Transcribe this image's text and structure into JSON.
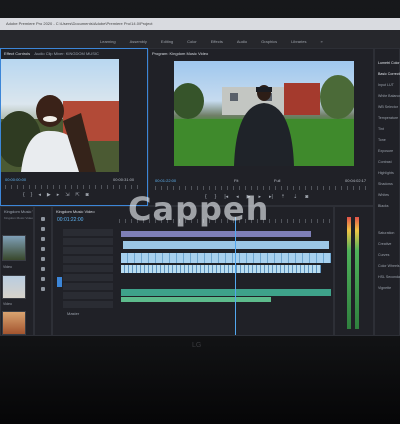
{
  "system_bar": {
    "text": "Adobe Premiere Pro 2020 - C:\\Users\\Documents\\Adobe\\Premiere Pro\\14.0\\Project"
  },
  "menu": {
    "items": [
      "Learning",
      "Assembly",
      "Editing",
      "Color",
      "Effects",
      "Audio",
      "Graphics",
      "Libraries",
      "»"
    ]
  },
  "source_panel": {
    "tabs": [
      "Effect Controls",
      "Audio Clip Mixer: KINGDOM MUSIC"
    ],
    "timecode_left": "00:00:00:00",
    "timecode_right": "00:00:31:00"
  },
  "program_panel": {
    "title": "Program: Kingdom Music Video",
    "timecode_left": "00:01:22:00",
    "fit": "Fit",
    "quality": "Full",
    "timecode_right": "00:04:02:17"
  },
  "left_panel": {
    "title": "Kingdom Music Vid",
    "subtitle": "Kingdom Music Video.prproj",
    "thumb_label_1": "Video",
    "thumb_label_2": "Video"
  },
  "timeline_panel": {
    "tabs": [
      "Kingdom Music Video"
    ],
    "timecode": "00:01:22:00",
    "footer": "Master"
  },
  "right_panel": {
    "title": "Lumetri Color",
    "header": "Basic Correction",
    "items": [
      "Input LUT",
      "White Balance",
      "WB Selector",
      "Temperature",
      "Tint",
      "Tone",
      "Exposure",
      "Contrast",
      "Highlights",
      "Shadows",
      "Whites",
      "Blacks"
    ],
    "lower_items": [
      "Saturation",
      "Creative",
      "Curves",
      "Color Wheels & Match",
      "HSL Secondary",
      "Vignette"
    ]
  },
  "watermark": {
    "text": "Cappeh"
  },
  "monitor_logo": {
    "text": "LG"
  }
}
